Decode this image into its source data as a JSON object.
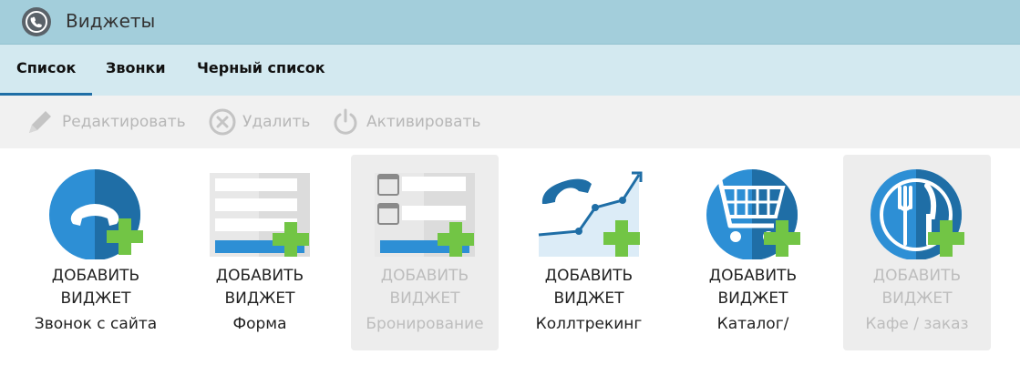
{
  "window": {
    "title": "Виджеты",
    "icon": "phone-icon"
  },
  "tabs": [
    {
      "label": "Список",
      "active": true
    },
    {
      "label": "Звонки",
      "active": false
    },
    {
      "label": "Черный список",
      "active": false
    }
  ],
  "toolbar": {
    "edit_label": "Редактировать",
    "delete_label": "Удалить",
    "activate_label": "Активировать"
  },
  "widgets": [
    {
      "line1": "ДОБАВИТЬ",
      "line2": "ВИДЖЕТ",
      "name": "Звонок с сайта",
      "icon": "phone-callback-icon",
      "disabled": false
    },
    {
      "line1": "ДОБАВИТЬ",
      "line2": "ВИДЖЕТ",
      "name": "Форма",
      "icon": "form-icon",
      "disabled": false
    },
    {
      "line1": "ДОБАВИТЬ",
      "line2": "ВИДЖЕТ",
      "name": "Бронирование",
      "icon": "booking-icon",
      "disabled": true
    },
    {
      "line1": "ДОБАВИТЬ",
      "line2": "ВИДЖЕТ",
      "name": "Коллтрекинг",
      "icon": "calltracking-icon",
      "disabled": false
    },
    {
      "line1": "ДОБАВИТЬ",
      "line2": "ВИДЖЕТ",
      "name": "Каталог/",
      "icon": "shopping-cart-icon",
      "disabled": false
    },
    {
      "line1": "ДОБАВИТЬ",
      "line2": "ВИДЖЕТ",
      "name": "Кафе / заказ",
      "icon": "cafe-plate-icon",
      "disabled": true
    }
  ],
  "colors": {
    "accent_blue": "#1f6ea6",
    "plus_green": "#72c545",
    "titlebar": "#a3cedb",
    "tabbar": "#d3e9f0"
  }
}
